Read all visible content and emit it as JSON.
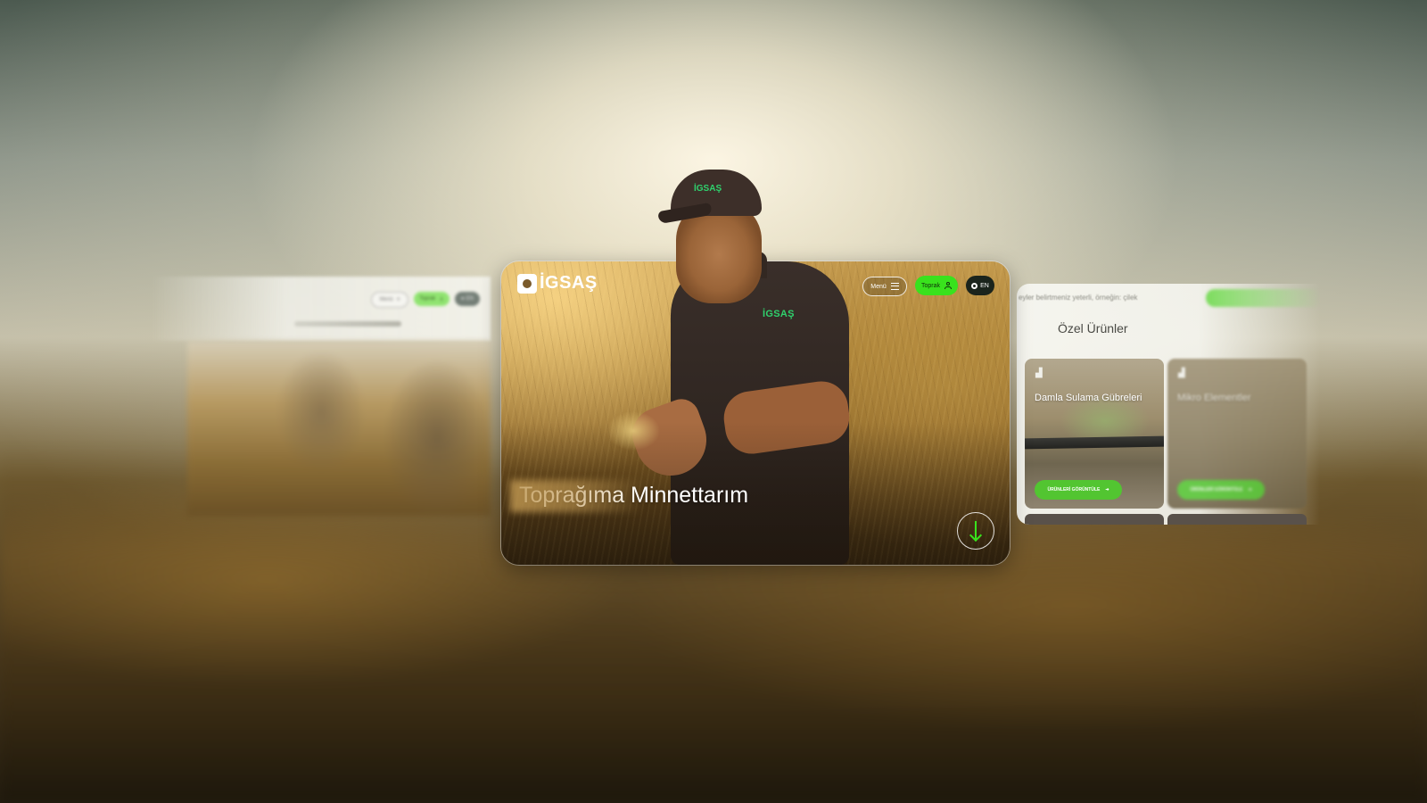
{
  "left_panel": {
    "nav": {
      "menu_label": "Menü",
      "toprak_label": "Toprak",
      "lang_label": "EN"
    }
  },
  "hero": {
    "brand": "İGSAŞ",
    "nav": {
      "menu_label": "Menü",
      "toprak_label": "Toprak",
      "lang_label": "EN"
    },
    "title": "Toprağıma Minnettarım",
    "shirt_logo": "İGSAŞ",
    "cap_logo": "İGSAŞ"
  },
  "right_panel": {
    "top_text": "eyler belirtmeniz yeterli, örneğin: çilek",
    "section_title": "Özel Ürünler",
    "cards": [
      {
        "icon": "tractor-icon",
        "title": "Damla Sulama Gübreleri",
        "button": "ÜRÜNLERİ GÖRÜNTÜLE"
      },
      {
        "icon": "tractor-icon",
        "title": "Mikro Elementler",
        "button": "ÜRÜNLERİ GÖRÜNTÜLE"
      }
    ]
  },
  "colors": {
    "accent_green": "#39e21d",
    "card_button_green": "#52c531",
    "dark_pill": "#1b241c"
  }
}
